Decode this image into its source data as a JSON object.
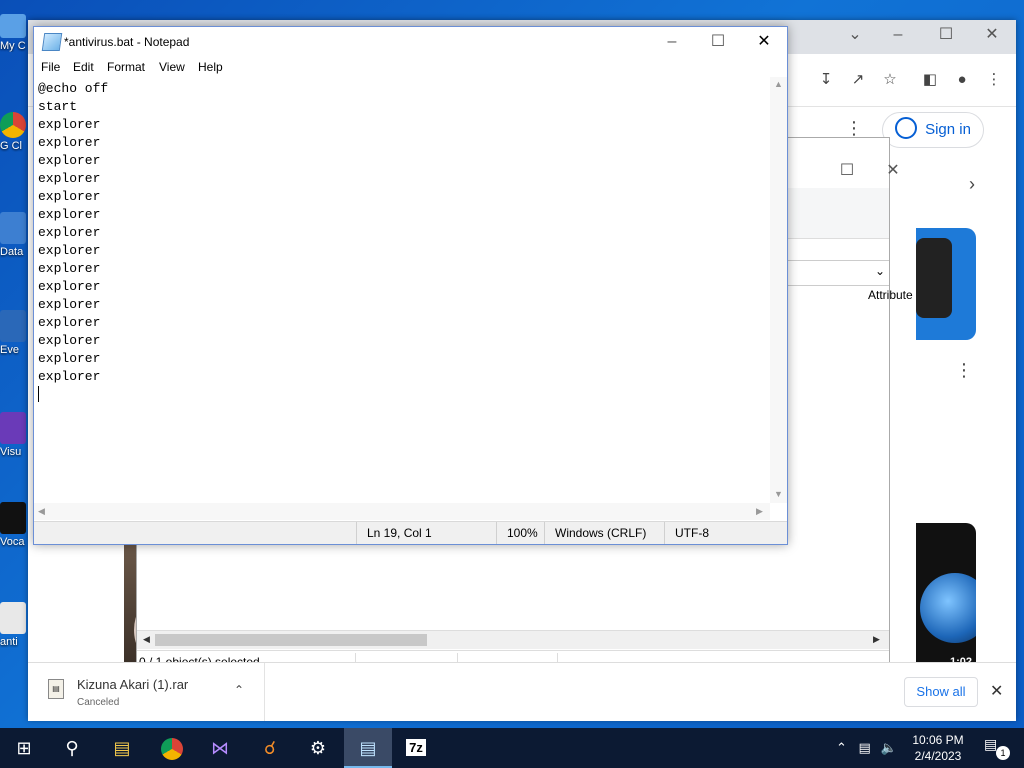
{
  "desktop": {
    "icons": [
      {
        "label": "My C"
      },
      {
        "label": "G Cl"
      },
      {
        "label": "Data"
      },
      {
        "label": "Eve"
      },
      {
        "label": "Visu"
      },
      {
        "label": "Voca"
      },
      {
        "label": "anti"
      }
    ]
  },
  "chrome": {
    "sign_in_label": "Sign in"
  },
  "explorer": {
    "column_header": "Attribute",
    "status_text": "0 / 1 object(s) selected"
  },
  "notepad": {
    "title": "*antivirus.bat - Notepad",
    "menu": [
      "File",
      "Edit",
      "Format",
      "View",
      "Help"
    ],
    "lines": [
      "@echo off",
      "start",
      "explorer",
      "explorer",
      "explorer",
      "explorer",
      "explorer",
      "explorer",
      "explorer",
      "explorer",
      "explorer",
      "explorer",
      "explorer",
      "explorer",
      "explorer",
      "explorer",
      "explorer"
    ],
    "status": {
      "position": "Ln 19, Col 1",
      "zoom": "100%",
      "line_ending": "Windows (CRLF)",
      "encoding": "UTF-8"
    }
  },
  "video": {
    "duration": "1:02"
  },
  "download_bar": {
    "file_name": "Kizuna Akari (1).rar",
    "file_status": "Canceled",
    "show_all_label": "Show all"
  },
  "taskbar": {
    "time": "10:06 PM",
    "date": "2/4/2023",
    "notification_count": "1",
    "items": [
      {
        "icon": "start-windows-icon"
      },
      {
        "icon": "search-icon"
      },
      {
        "icon": "file-explorer-icon"
      },
      {
        "icon": "chrome-icon"
      },
      {
        "icon": "visual-studio-icon"
      },
      {
        "icon": "search-tool-icon"
      },
      {
        "icon": "settings-gear-icon"
      },
      {
        "icon": "notepad-icon"
      },
      {
        "icon": "7zip-icon"
      }
    ],
    "seven_zip_label": "7z"
  }
}
